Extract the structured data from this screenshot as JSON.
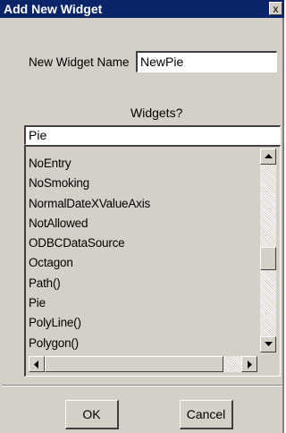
{
  "dialog": {
    "title": "Add New Widget",
    "close_glyph": "x"
  },
  "name_field": {
    "label": "New Widget Name",
    "value": "NewPie"
  },
  "widgets_label": "Widgets?",
  "filter_field": {
    "value": "Pie"
  },
  "widget_list": {
    "items": [
      "NoEntry",
      "NoSmoking",
      "NormalDateXValueAxis",
      "NotAllowed",
      "ODBCDataSource",
      "Octagon",
      "Path()",
      "Pie",
      "PolyLine()",
      "Polygon()"
    ]
  },
  "buttons": {
    "ok": "OK",
    "cancel": "Cancel"
  },
  "icons": {
    "scroll_up": "triangle-up-icon",
    "scroll_down": "triangle-down-icon",
    "scroll_left": "triangle-left-icon",
    "scroll_right": "triangle-right-icon"
  }
}
